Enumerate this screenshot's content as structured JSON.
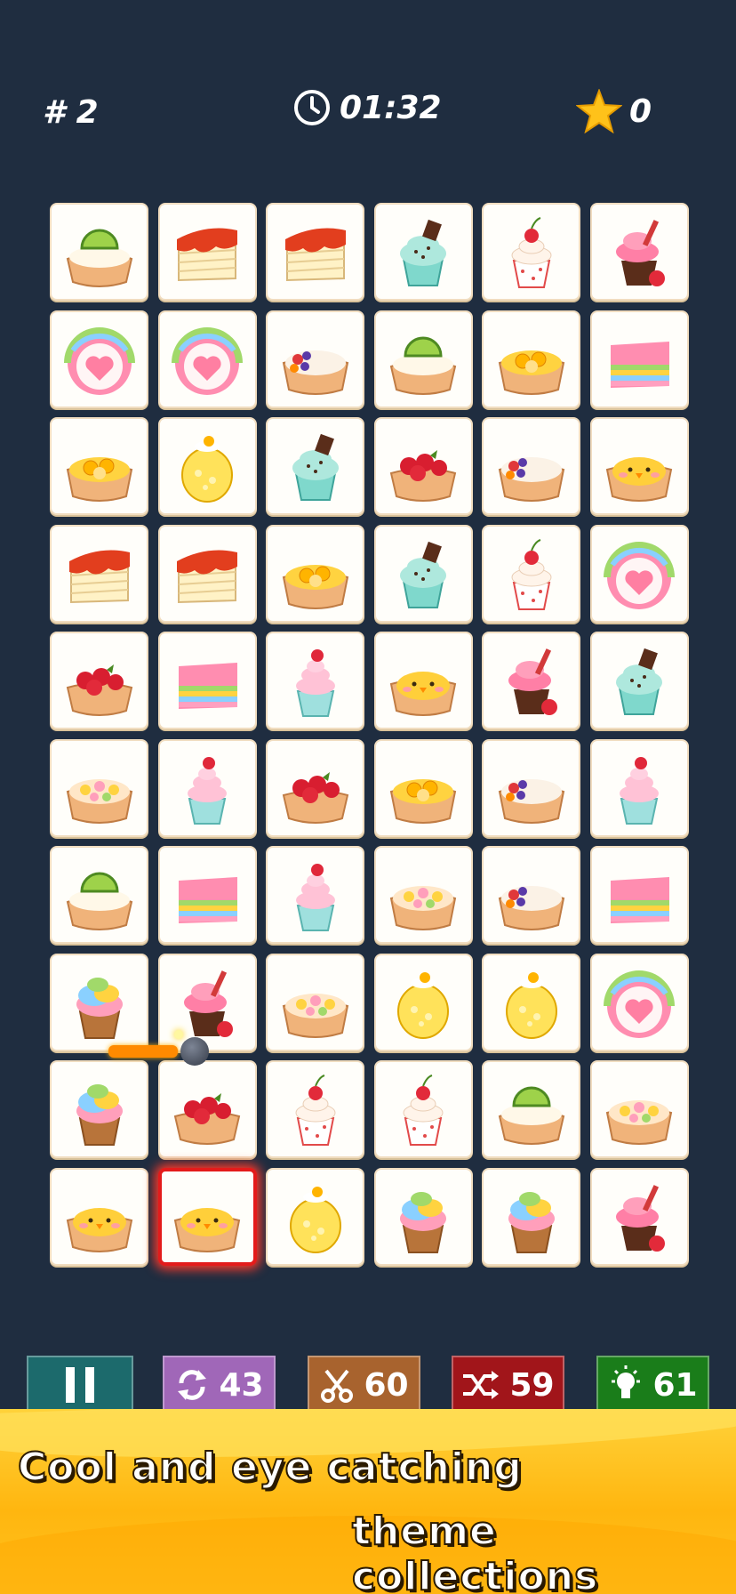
{
  "hud": {
    "level": "# 2",
    "timer": "01:32",
    "stars": "0"
  },
  "toolbar": {
    "pause_label": "",
    "refresh_count": "43",
    "cut_count": "60",
    "shuffle_count": "59",
    "hint_count": "61",
    "colors": {
      "pause": "#1c6a6c",
      "refresh": "#a067b8",
      "cut": "#a8632e",
      "shuffle": "#a1151a",
      "hint": "#1a7d1a"
    }
  },
  "banner": {
    "line1": "Cool and eye catching",
    "line2": "theme collections"
  },
  "board": {
    "columns": 6,
    "rows": 10,
    "selected": [
      9,
      1
    ],
    "tiles": [
      [
        "lime-tart",
        "jam-cake",
        "jam-cake",
        "mint-cupcake",
        "cherry-cupcake",
        "pink-cupcake"
      ],
      [
        "heart-roll",
        "heart-roll",
        "berry-tart",
        "lime-tart",
        "orange-tart",
        "rainbow-cake"
      ],
      [
        "orange-tart",
        "lemon-roll",
        "mint-cupcake",
        "raspberry-tart",
        "berry-tart",
        "chick-tart"
      ],
      [
        "jam-cake",
        "jam-cake",
        "orange-tart",
        "mint-cupcake",
        "cherry-cupcake",
        "heart-roll"
      ],
      [
        "raspberry-tart",
        "rainbow-cake",
        "raspberry-cupcake",
        "chick-tart",
        "pink-cupcake",
        "mint-cupcake"
      ],
      [
        "flower-tart",
        "raspberry-cupcake",
        "raspberry-tart",
        "orange-tart",
        "berry-tart",
        "raspberry-cupcake"
      ],
      [
        "lime-tart",
        "rainbow-cake",
        "raspberry-cupcake",
        "flower-tart",
        "berry-tart",
        "rainbow-cake"
      ],
      [
        "rainbow-cupcake",
        "pink-cupcake",
        "flower-tart",
        "lemon-roll",
        "lemon-roll",
        "heart-roll"
      ],
      [
        "rainbow-cupcake",
        "raspberry-tart",
        "cherry-cupcake",
        "cherry-cupcake",
        "lime-tart",
        "flower-tart"
      ],
      [
        "chick-tart",
        "chick-tart",
        "lemon-roll",
        "rainbow-cupcake",
        "rainbow-cupcake",
        "pink-cupcake"
      ]
    ]
  }
}
